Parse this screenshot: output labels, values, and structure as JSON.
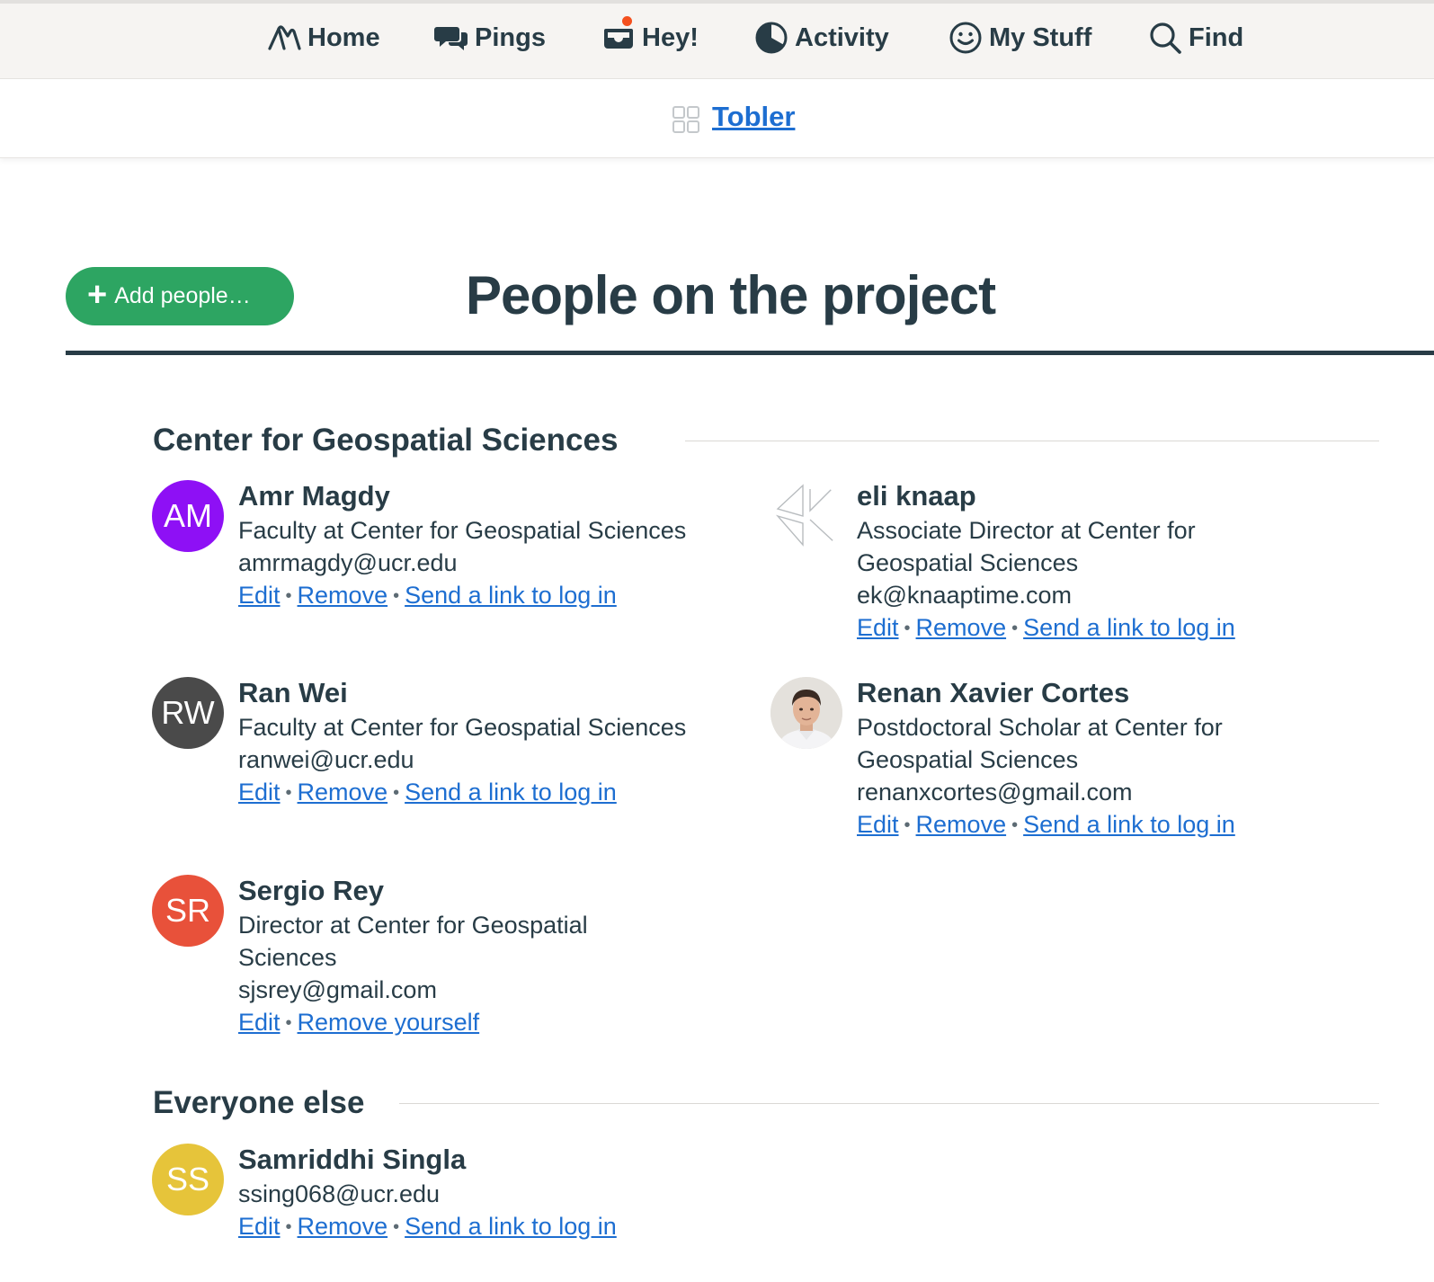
{
  "nav": {
    "home": "Home",
    "pings": "Pings",
    "hey": "Hey!",
    "activity": "Activity",
    "my_stuff": "My Stuff",
    "find": "Find"
  },
  "project": {
    "name": "Tobler"
  },
  "header": {
    "add_button": "Add people…",
    "title": "People on the project"
  },
  "groups": [
    {
      "heading": "Center for Geospatial Sciences",
      "people": [
        {
          "initials": "AM",
          "avatar_color": "#8e10f5",
          "name": "Amr Magdy",
          "role": "Faculty at Center for Geospatial Sciences",
          "email": "amrmagdy@ucr.edu",
          "actions": [
            "Edit",
            "Remove",
            "Send a link to log in"
          ]
        },
        {
          "avatar_icon": "geometric-logo-icon",
          "name": "eli knaap",
          "role_line1": "Associate Director at Center for",
          "role_line2": "Geospatial Sciences",
          "email": "ek@knaaptime.com",
          "actions": [
            "Edit",
            "Remove",
            "Send a link to log in"
          ]
        },
        {
          "initials": "RW",
          "avatar_color": "#4a4a4a",
          "name": "Ran Wei",
          "role": "Faculty at Center for Geospatial Sciences",
          "email": "ranwei@ucr.edu",
          "actions": [
            "Edit",
            "Remove",
            "Send a link to log in"
          ]
        },
        {
          "avatar_icon": "profile-photo",
          "name": "Renan Xavier Cortes",
          "role_line1": "Postdoctoral Scholar at Center for",
          "role_line2": "Geospatial Sciences",
          "email": "renanxcortes@gmail.com",
          "actions": [
            "Edit",
            "Remove",
            "Send a link to log in"
          ]
        },
        {
          "initials": "SR",
          "avatar_color": "#e8513a",
          "name": "Sergio Rey",
          "role_line1": "Director at Center for Geospatial",
          "role_line2": "Sciences",
          "email": "sjsrey@gmail.com",
          "actions": [
            "Edit",
            "Remove yourself"
          ]
        }
      ]
    },
    {
      "heading": "Everyone else",
      "people": [
        {
          "initials": "SS",
          "avatar_color": "#e6c43a",
          "name": "Samriddhi Singla",
          "email": "ssing068@ucr.edu",
          "actions": [
            "Edit",
            "Remove",
            "Send a link to log in"
          ]
        }
      ]
    }
  ],
  "colors": {
    "link": "#1d6ed1",
    "text": "#283c46",
    "add_button": "#2da562",
    "notification_dot": "#f4501e",
    "nav_background": "#f6f4f2"
  }
}
